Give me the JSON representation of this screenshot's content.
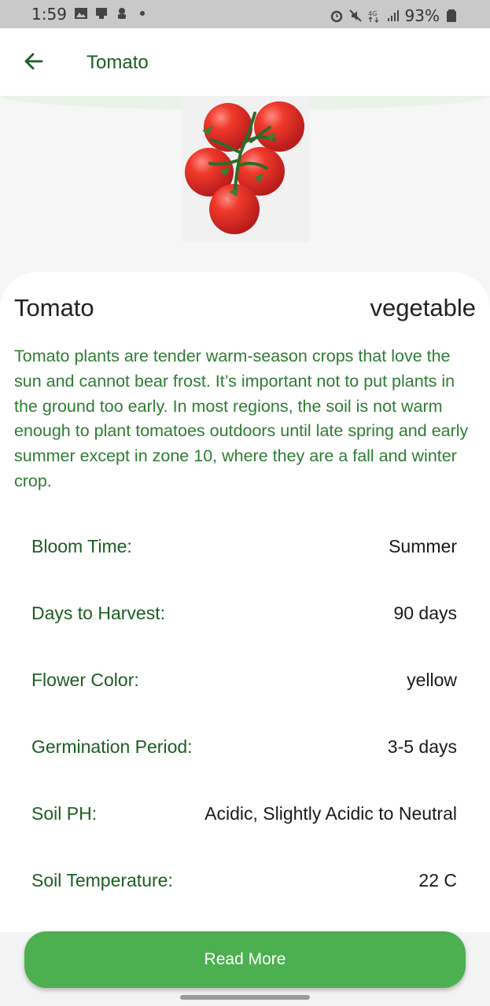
{
  "status_bar": {
    "time": "1:59",
    "battery": "93%",
    "icons": [
      "image-icon",
      "cast-icon",
      "notification-icon",
      "dot-icon",
      "alarm-icon",
      "mute-icon",
      "4g-icon",
      "signal-icon",
      "battery-icon"
    ]
  },
  "app_bar": {
    "title": "Tomato",
    "back_icon": "arrow-back-icon"
  },
  "plant": {
    "name": "Tomato",
    "type": "vegetable",
    "description": "Tomato plants are tender warm-season crops that love the sun and cannot bear frost. It’s important not to put plants in the ground too early. In most regions, the soil is not warm enough to plant tomatoes outdoors until late spring and early summer except in zone 10, where they are a fall and winter crop."
  },
  "attributes": [
    {
      "label": "Bloom Time:",
      "value": "Summer"
    },
    {
      "label": "Days to Harvest:",
      "value": "90 days"
    },
    {
      "label": "Flower Color:",
      "value": "yellow"
    },
    {
      "label": "Germination Period:",
      "value": "3-5 days"
    },
    {
      "label": "Soil PH:",
      "value": "Acidic, Slightly Acidic to Neutral"
    },
    {
      "label": "Soil Temperature:",
      "value": "22 C"
    }
  ],
  "actions": {
    "read_more": "Read More"
  },
  "colors": {
    "primary": "#4caf50",
    "dark_green": "#1b5e20",
    "text_green": "#2e7d32"
  }
}
